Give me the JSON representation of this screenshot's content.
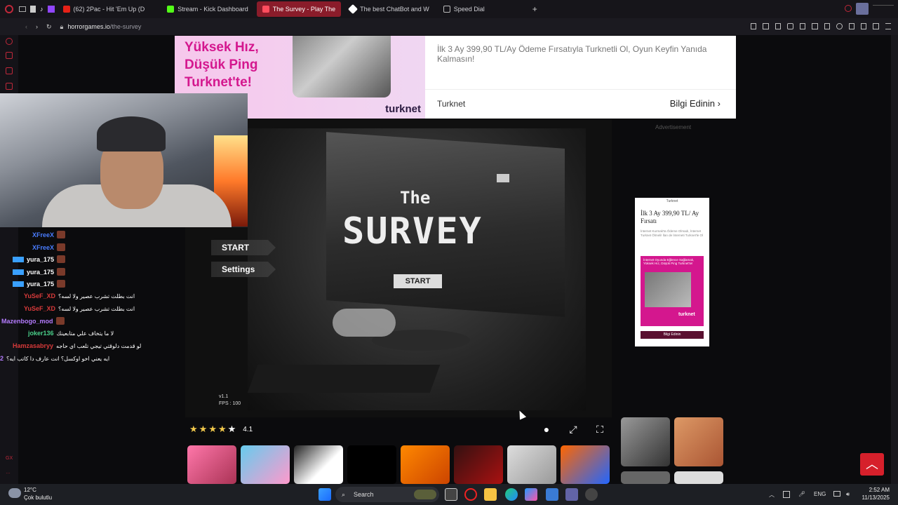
{
  "browser": {
    "tabs": [
      {
        "label": "(62) 2Pac - Hit 'Em Up (D",
        "color": "#e62117"
      },
      {
        "label": "Stream - Kick Dashboard",
        "color": "#53fc18"
      },
      {
        "label": "The Survey - Play The",
        "color": "#c0283a",
        "active": true
      },
      {
        "label": "The best ChatBot and W",
        "color": "#ffffff"
      },
      {
        "label": "Speed Dial",
        "color": "#bbbbbb"
      }
    ],
    "new_tab": "+",
    "url_host": "horrorgames.io",
    "url_path": "/the-survey"
  },
  "top_ad": {
    "headline": "Yüksek Hız, Düşük Ping Turknet'te!",
    "brand_logo": "turknet",
    "description": "İlk 3 Ay 399,90 TL/Ay Ödeme Fırsatıyla Turknetli Ol, Oyun Keyfin Yanıda Kalmasın!",
    "advertiser": "Turknet",
    "cta": "Bilgi Edinin"
  },
  "ad_label": "Advertisement",
  "game": {
    "title_small": "The",
    "title_big": "SURVEY",
    "monitor_button": "START",
    "menu": [
      "START",
      "Settings"
    ],
    "version": "v1.1",
    "fps": "FPS : 100",
    "rating": "4.1",
    "stars": 5
  },
  "side_ad": {
    "brand_small": "Turknet",
    "headline": "İlk 3 Ay 399,90 TL/ Ay Fırsatı",
    "sub": "İnternet Kurmak'ta Ödeme Olmadı, İnternet Turknet Ölmeli! İlan de İnterneti Turknet'le Ol",
    "promo": "İnternet Oyunda Eğlence Sağlamak, Yüksek Hız, Düşük Ping Turknet'te!",
    "logo": "turknet",
    "cta": "Bilgi Edinin"
  },
  "chat": [
    {
      "user": "XFreeX",
      "color": "#4a7dff",
      "msg": ""
    },
    {
      "user": "XFreeX",
      "color": "#4a7dff",
      "msg": ""
    },
    {
      "user": "yura_175",
      "color": "#ffffff",
      "msg": ""
    },
    {
      "user": "yura_175",
      "color": "#ffffff",
      "msg": ""
    },
    {
      "user": "yura_175",
      "color": "#ffffff",
      "msg": ""
    },
    {
      "user": "YuSeF_XD",
      "color": "#d83a3a",
      "msg": "انت بطلت تشرب عصير ولا لسه؟"
    },
    {
      "user": "YuSeF_XD",
      "color": "#d83a3a",
      "msg": "انت بطلت تشرب عصير ولا لسه؟"
    },
    {
      "user": "Mazenbogo_mod",
      "color": "#b57cff",
      "msg": ""
    },
    {
      "user": "joker136",
      "color": "#4ad08a",
      "msg": "لا ما يتخاف علي متابعينك"
    },
    {
      "user": "Hamzasabryy",
      "color": "#d83a3a",
      "msg": "لو قدمت دلوقتي تيجي تلعب اي حاجه"
    },
    {
      "user": "2",
      "color": "#b57cff",
      "msg": "ايه يعني اخو اوكسل؟ انت عارف دا كاتب ايه؟"
    }
  ],
  "taskbar": {
    "temp": "12°C",
    "weather": "Çok bulutlu",
    "search": "Search",
    "lang": "ENG",
    "time": "2:52 AM",
    "date": "11/13/2025"
  }
}
